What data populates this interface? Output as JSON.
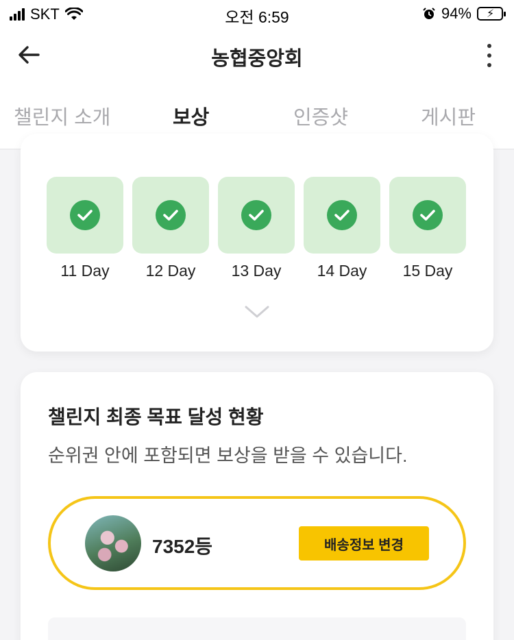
{
  "status_bar": {
    "carrier": "SKT",
    "time": "오전 6:59",
    "battery_percent": "94%",
    "icons": [
      "signal-icon",
      "wifi-icon",
      "alarm-icon",
      "battery-charging-icon"
    ]
  },
  "header": {
    "title": "농협중앙회",
    "icons": [
      "back-arrow-icon",
      "more-vertical-icon"
    ]
  },
  "tabs": [
    {
      "label": "챌린지 소개",
      "active": false
    },
    {
      "label": "보상",
      "active": true
    },
    {
      "label": "인증샷",
      "active": false
    },
    {
      "label": "게시판",
      "active": false
    }
  ],
  "progress": {
    "days": [
      {
        "label": "11 Day",
        "completed": true
      },
      {
        "label": "12 Day",
        "completed": true
      },
      {
        "label": "13 Day",
        "completed": true
      },
      {
        "label": "14 Day",
        "completed": true
      },
      {
        "label": "15 Day",
        "completed": true
      }
    ],
    "expand_icon": "chevron-down-icon"
  },
  "goal": {
    "title": "챌린지 최종 목표 달성 현황",
    "description": "순위권 안에 포함되면 보상을 받을 수 있습니다.",
    "rank": "7352등",
    "shipping_button": "배송정보 변경"
  },
  "colors": {
    "accent_yellow": "#f8c400",
    "pill_border": "#f5c518",
    "day_bg": "#d8efd6",
    "check_green": "#3aa95a"
  }
}
